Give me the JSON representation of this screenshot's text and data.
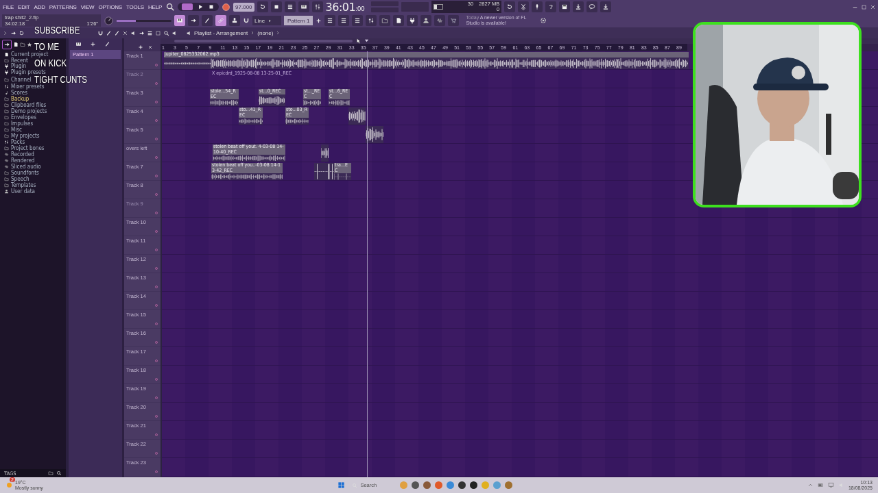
{
  "menu": [
    "FILE",
    "EDIT",
    "ADD",
    "PATTERNS",
    "VIEW",
    "OPTIONS",
    "TOOLS",
    "HELP"
  ],
  "transport": {
    "tempo": "97.000",
    "time": "36:01",
    "time_sub": ":00",
    "record_armed": true,
    "song_mode": true
  },
  "master_slider": {
    "level": 0.35
  },
  "project": {
    "file": "trap shit2_2.flp",
    "position": "34:02:18",
    "length": "1'26\""
  },
  "toggles": [
    {
      "on": true
    },
    {
      "on": false
    },
    {
      "on": false
    },
    {
      "on": true
    },
    {
      "on": false
    }
  ],
  "snap": "Line",
  "pattern_selector": "Pattern 1",
  "monitor": {
    "cpu": "30",
    "memory": "2827 MB",
    "voices": "0",
    "level": 0.3
  },
  "help": "?",
  "news": {
    "date": "Today",
    "text": "A newer version of FL Studio is available!"
  },
  "browser": {
    "items": [
      {
        "label": "Current project",
        "selected": false
      },
      {
        "label": "Recent",
        "selected": false
      },
      {
        "label": "Plugin",
        "selected": false
      },
      {
        "label": "Plugin presets",
        "selected": false
      },
      {
        "label": "Channel",
        "selected": false
      },
      {
        "label": "Mixer presets",
        "selected": false
      },
      {
        "label": "Scores",
        "selected": false
      },
      {
        "label": "Backup",
        "selected": true
      },
      {
        "label": "Clipboard files",
        "selected": false
      },
      {
        "label": "Demo projects",
        "selected": false
      },
      {
        "label": "Envelopes",
        "selected": false
      },
      {
        "label": "Impulses",
        "selected": false
      },
      {
        "label": "Misc",
        "selected": false
      },
      {
        "label": "My projects",
        "selected": false
      },
      {
        "label": "Packs",
        "selected": false
      },
      {
        "label": "Project bones",
        "selected": false
      },
      {
        "label": "Recorded",
        "selected": false
      },
      {
        "label": "Rendered",
        "selected": false
      },
      {
        "label": "Sliced audio",
        "selected": false
      },
      {
        "label": "Soundfonts",
        "selected": false
      },
      {
        "label": "Speech",
        "selected": false
      },
      {
        "label": "Templates",
        "selected": false
      },
      {
        "label": "User data",
        "selected": false
      }
    ],
    "tags": "TAGS"
  },
  "patterns": [
    {
      "name": "Pattern 1",
      "selected": true
    }
  ],
  "playlist": {
    "title": "Playlist - Arrangement",
    "pattern": "(none)",
    "ruler": [
      "1",
      "3",
      "5",
      "7",
      "9",
      "11",
      "13",
      "15",
      "17",
      "19",
      "21",
      "23",
      "25",
      "27",
      "29",
      "31",
      "33",
      "35",
      "37",
      "39",
      "41",
      "43",
      "45",
      "47",
      "49",
      "51",
      "53",
      "55",
      "57",
      "59",
      "61",
      "63",
      "65",
      "67",
      "69",
      "71",
      "73",
      "75",
      "77",
      "79",
      "81",
      "83",
      "85",
      "87",
      "89"
    ],
    "tracks": [
      {
        "name": "Track 1",
        "disabled": false
      },
      {
        "name": "Track 2",
        "disabled": true
      },
      {
        "name": "Track 3",
        "disabled": false
      },
      {
        "name": "Track 4",
        "disabled": false
      },
      {
        "name": "Track 5",
        "disabled": false
      },
      {
        "name": "overs left",
        "disabled": false
      },
      {
        "name": "Track 7",
        "disabled": false
      },
      {
        "name": "Track 8",
        "disabled": false
      },
      {
        "name": "Track 9",
        "disabled": true
      },
      {
        "name": "Track 10",
        "disabled": false
      },
      {
        "name": "Track 11",
        "disabled": false
      },
      {
        "name": "Track 12",
        "disabled": false
      },
      {
        "name": "Track 13",
        "disabled": false
      },
      {
        "name": "Track 14",
        "disabled": false
      },
      {
        "name": "Track 15",
        "disabled": false
      },
      {
        "name": "Track 16",
        "disabled": false
      },
      {
        "name": "Track 17",
        "disabled": false
      },
      {
        "name": "Track 18",
        "disabled": false
      },
      {
        "name": "Track 19",
        "disabled": false
      },
      {
        "name": "Track 20",
        "disabled": false
      },
      {
        "name": "Track 21",
        "disabled": false
      },
      {
        "name": "Track 22",
        "disabled": false
      },
      {
        "name": "Track 23",
        "disabled": false
      }
    ],
    "clips": [
      {
        "name": "jupiter_0825332062.mp3",
        "disabled": false
      },
      {
        "name": "X epicdrd_1925-08-08 13-25-01_REC",
        "disabled": true
      },
      {
        "name": "stole...54_REC",
        "disabled": false
      },
      {
        "name": "st...0_REC",
        "disabled": false
      },
      {
        "name": "st..._REC",
        "disabled": false
      },
      {
        "name": "st...6_REC",
        "disabled": false
      },
      {
        "name": "sto...41_REC",
        "disabled": false
      },
      {
        "name": "sto...03_REC",
        "disabled": false
      },
      {
        "disabled": false
      },
      {
        "disabled": false
      },
      {
        "name": "stolen beat off yout. 4-03-08 14-10-40_REC",
        "disabled": false
      },
      {
        "disabled": false
      },
      {
        "name": "stolen beat off you..-03-08 14-13-42_REC",
        "disabled": false
      },
      {
        "disabled": false
      },
      {
        "disabled": false
      },
      {
        "name": "tra...EC",
        "disabled": false
      }
    ]
  },
  "overlay": [
    "SUBSCRIBE",
    "TO ME",
    "ON KICK",
    "TIGHT CUNTS"
  ],
  "webcam": {
    "kind": "picture"
  },
  "taskbar": {
    "temperature": "19°C",
    "weather": "Mostly sunny",
    "weather_badge": "2",
    "search": "Search",
    "time": "10:13",
    "date": "18/08/2025"
  }
}
